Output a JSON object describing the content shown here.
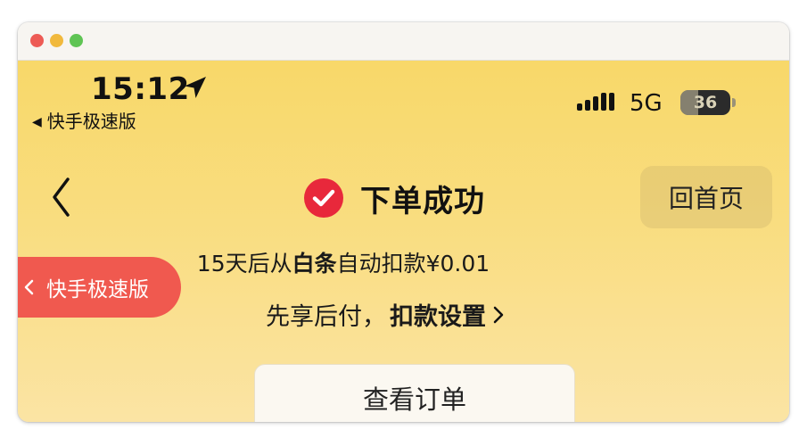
{
  "status_bar": {
    "time": "15:12",
    "back_to_app": "快手极速版",
    "network": "5G",
    "battery": "36",
    "battery_level": 0.36
  },
  "nav": {
    "title": "下单成功",
    "home_button": "回首页"
  },
  "info": {
    "line1_prefix": "15天后从",
    "line1_bold": "白条",
    "line1_suffix": "自动扣款¥0.01",
    "line2_prefix": "先享后付，",
    "line2_link": "扣款设置"
  },
  "floating_pill": {
    "label": "快手极速版"
  },
  "actions": {
    "view_order": "查看订单"
  },
  "colors": {
    "accent_red": "#f0594f",
    "check_red": "#e8283b",
    "background_yellow": "#f9dd80"
  },
  "icons": [
    "location-arrow-icon",
    "back-triangle-icon",
    "signal-icon",
    "battery-icon",
    "back-chevron-icon",
    "check-circle-icon",
    "chevron-right-icon",
    "chevron-left-icon"
  ]
}
